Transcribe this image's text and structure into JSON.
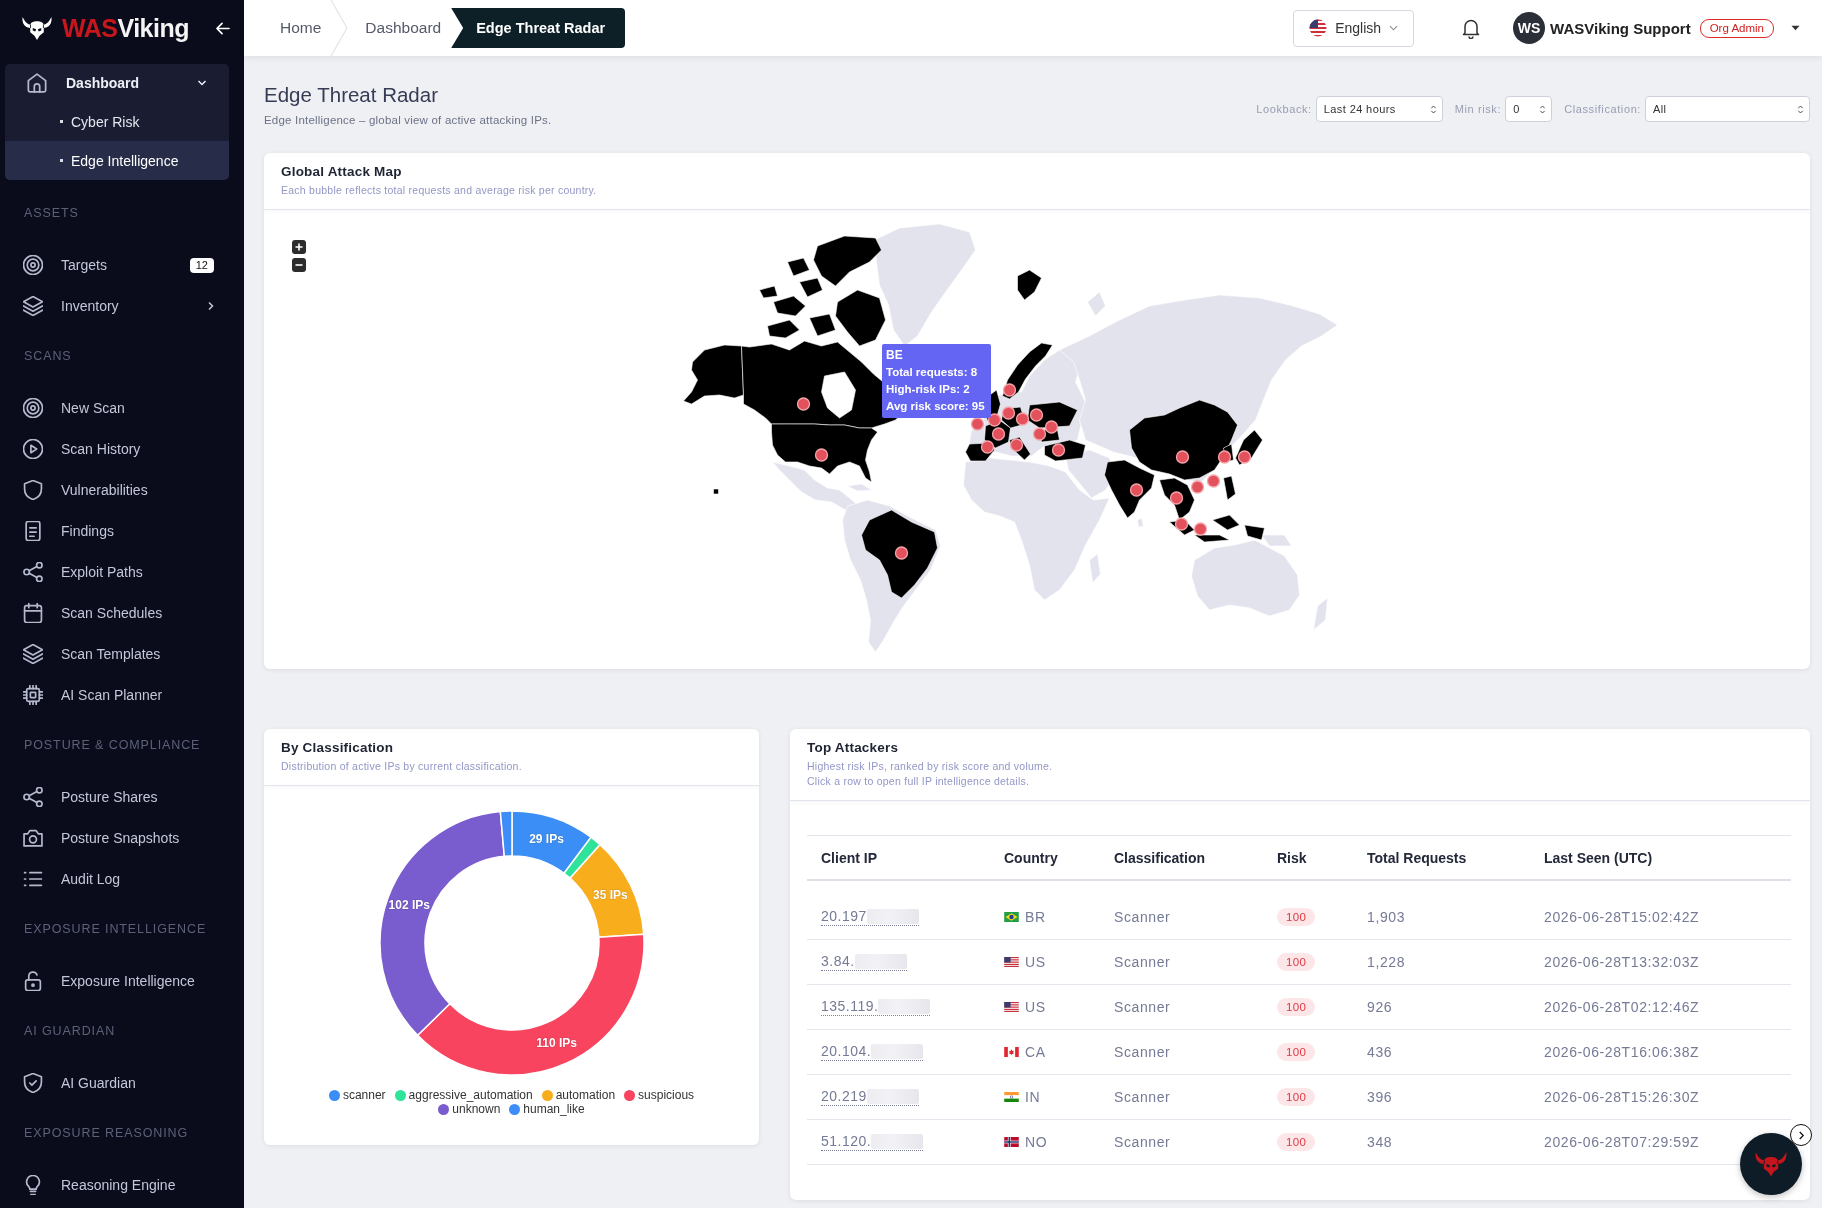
{
  "sidebar": {
    "brand": {
      "accent": "WAS",
      "rest": "Viking"
    },
    "menu": [
      {
        "label": "Dashboard",
        "expanded": true,
        "children": [
          {
            "label": "Cyber Risk",
            "selected": false
          },
          {
            "label": "Edge Intelligence",
            "selected": true
          }
        ]
      }
    ],
    "sections": [
      {
        "title": "ASSETS",
        "items": [
          {
            "label": "Targets",
            "badge": "12"
          },
          {
            "label": "Inventory",
            "expanded": false
          }
        ]
      },
      {
        "title": "SCANS",
        "items": [
          {
            "label": "New Scan"
          },
          {
            "label": "Scan History"
          },
          {
            "label": "Vulnerabilities"
          },
          {
            "label": "Findings"
          },
          {
            "label": "Exploit Paths"
          },
          {
            "label": "Scan Schedules"
          },
          {
            "label": "Scan Templates"
          },
          {
            "label": "AI Scan Planner"
          }
        ]
      },
      {
        "title": "POSTURE & COMPLIANCE",
        "items": [
          {
            "label": "Posture Shares"
          },
          {
            "label": "Posture Snapshots"
          },
          {
            "label": "Audit Log"
          }
        ]
      },
      {
        "title": "EXPOSURE INTELLIGENCE",
        "items": [
          {
            "label": "Exposure Intelligence"
          }
        ]
      },
      {
        "title": "AI GUARDIAN",
        "items": [
          {
            "label": "AI Guardian"
          }
        ]
      },
      {
        "title": "EXPOSURE REASONING",
        "items": [
          {
            "label": "Reasoning Engine"
          }
        ]
      }
    ]
  },
  "breadcrumb": [
    {
      "label": "Home",
      "selected": false
    },
    {
      "label": "Dashboard",
      "selected": false
    },
    {
      "label": "Edge Threat Radar",
      "selected": true
    }
  ],
  "topbar": {
    "language": "English",
    "user": {
      "initials": "WS",
      "name": "WASViking Support",
      "role": "Org Admin"
    }
  },
  "page": {
    "title": "Edge Threat Radar",
    "subtitle": "Edge Intelligence – global view of active attacking IPs."
  },
  "filters": [
    {
      "label": "Lookback:",
      "value": "Last 24 hours"
    },
    {
      "label": "Min risk:",
      "value": "0"
    },
    {
      "label": "Classification:",
      "value": "All"
    }
  ],
  "attack_map": {
    "title": "Global Attack Map",
    "subtitle": "Each bubble reflects total requests and average risk per country.",
    "tooltip": {
      "title": "BE",
      "lines": [
        "Total requests: 8",
        "High-risk IPs: 2",
        "Avg risk score: 95"
      ]
    }
  },
  "by_classification": {
    "title": "By Classification",
    "subtitle": "Distribution of active IPs by current classification.",
    "chart_data": {
      "type": "donut",
      "categories": [
        "scanner",
        "aggressive_automation",
        "automation",
        "suspicious",
        "unknown",
        "human_like"
      ],
      "values": [
        29,
        4,
        35,
        110,
        102,
        4
      ],
      "colors": [
        "#3b8ef5",
        "#2fe39a",
        "#f8ad1d",
        "#f8445f",
        "#795cce",
        "#3d8cf7"
      ],
      "value_labels": [
        "29 IPs",
        null,
        "35 IPs",
        "110 IPs",
        "102 IPs",
        null
      ],
      "legend": "bottom"
    }
  },
  "top_attackers": {
    "title": "Top Attackers",
    "subtitle": [
      "Highest risk IPs, ranked by risk score and volume.",
      "Click a row to open full IP intelligence details."
    ],
    "columns": [
      "Client IP",
      "Country",
      "Classification",
      "Risk",
      "Total Requests",
      "Last Seen (UTC)"
    ],
    "rows": [
      {
        "client_ip": "20.197",
        "ip_redacted": true,
        "country": "BR",
        "classification": "Scanner",
        "risk": "100",
        "total_requests": "1,903",
        "last_seen": "2026-06-28T15:02:42Z"
      },
      {
        "client_ip": "3.84.",
        "ip_redacted": true,
        "country": "US",
        "classification": "Scanner",
        "risk": "100",
        "total_requests": "1,228",
        "last_seen": "2026-06-28T13:32:03Z"
      },
      {
        "client_ip": "135.119.",
        "ip_redacted": true,
        "country": "US",
        "classification": "Scanner",
        "risk": "100",
        "total_requests": "926",
        "last_seen": "2026-06-28T02:12:46Z"
      },
      {
        "client_ip": "20.104.",
        "ip_redacted": true,
        "country": "CA",
        "classification": "Scanner",
        "risk": "100",
        "total_requests": "436",
        "last_seen": "2026-06-28T16:06:38Z"
      },
      {
        "client_ip": "20.219",
        "ip_redacted": true,
        "country": "IN",
        "classification": "Scanner",
        "risk": "100",
        "total_requests": "396",
        "last_seen": "2026-06-28T15:26:30Z"
      },
      {
        "client_ip": "51.120.",
        "ip_redacted": true,
        "country": "NO",
        "classification": "Scanner",
        "risk": "100",
        "total_requests": "348",
        "last_seen": "2026-06-28T07:29:59Z"
      }
    ]
  }
}
